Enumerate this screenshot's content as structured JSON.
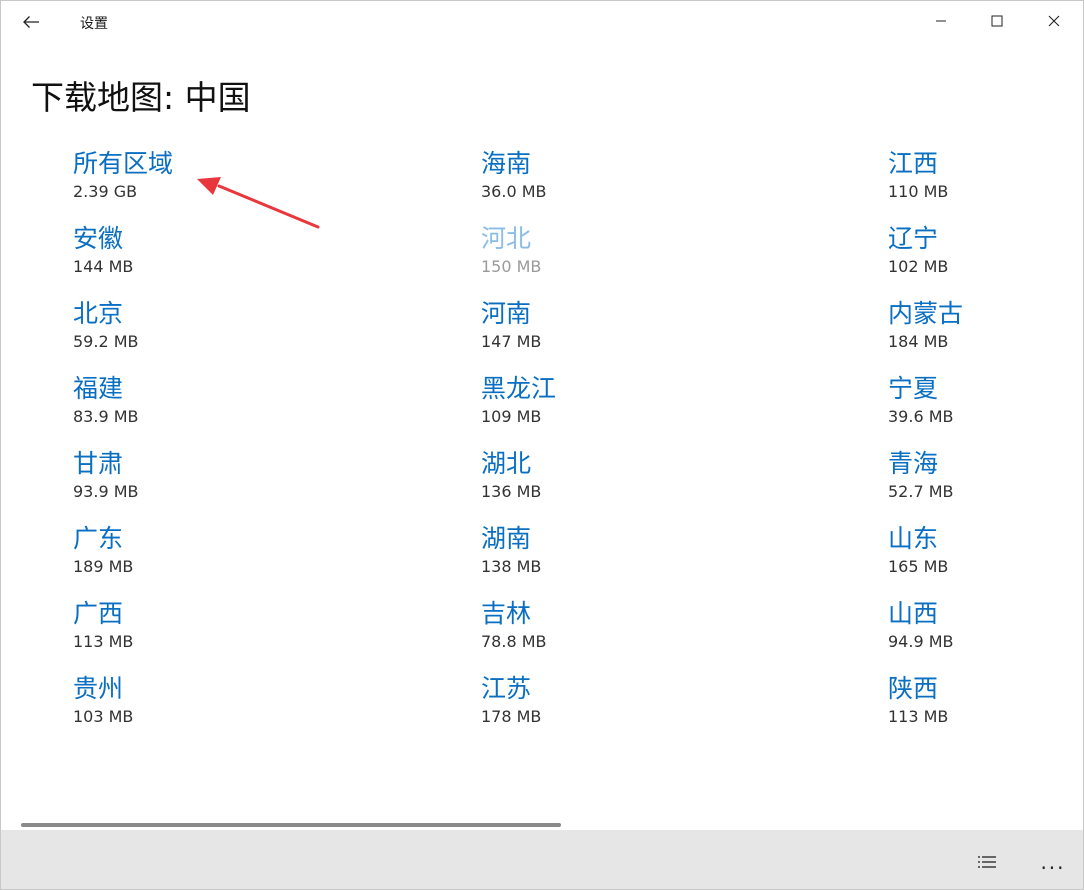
{
  "window": {
    "title": "设置"
  },
  "page": {
    "title": "下载地图: 中国"
  },
  "regions": [
    {
      "name": "所有区域",
      "size": "2.39 GB",
      "disabled": false
    },
    {
      "name": "安徽",
      "size": "144 MB",
      "disabled": false
    },
    {
      "name": "北京",
      "size": "59.2 MB",
      "disabled": false
    },
    {
      "name": "福建",
      "size": "83.9 MB",
      "disabled": false
    },
    {
      "name": "甘肃",
      "size": "93.9 MB",
      "disabled": false
    },
    {
      "name": "广东",
      "size": "189 MB",
      "disabled": false
    },
    {
      "name": "广西",
      "size": "113 MB",
      "disabled": false
    },
    {
      "name": "贵州",
      "size": "103 MB",
      "disabled": false
    },
    {
      "name": "海南",
      "size": "36.0 MB",
      "disabled": false
    },
    {
      "name": "河北",
      "size": "150 MB",
      "disabled": true
    },
    {
      "name": "河南",
      "size": "147 MB",
      "disabled": false
    },
    {
      "name": "黑龙江",
      "size": "109 MB",
      "disabled": false
    },
    {
      "name": "湖北",
      "size": "136 MB",
      "disabled": false
    },
    {
      "name": "湖南",
      "size": "138 MB",
      "disabled": false
    },
    {
      "name": "吉林",
      "size": "78.8 MB",
      "disabled": false
    },
    {
      "name": "江苏",
      "size": "178 MB",
      "disabled": false
    },
    {
      "name": "江西",
      "size": "110 MB",
      "disabled": false
    },
    {
      "name": "辽宁",
      "size": "102 MB",
      "disabled": false
    },
    {
      "name": "内蒙古",
      "size": "184 MB",
      "disabled": false
    },
    {
      "name": "宁夏",
      "size": "39.6 MB",
      "disabled": false
    },
    {
      "name": "青海",
      "size": "52.7 MB",
      "disabled": false
    },
    {
      "name": "山东",
      "size": "165 MB",
      "disabled": false
    },
    {
      "name": "山西",
      "size": "94.9 MB",
      "disabled": false
    },
    {
      "name": "陕西",
      "size": "113 MB",
      "disabled": false
    }
  ],
  "icons": {
    "back": "back-arrow-icon",
    "minimize": "minimize-icon",
    "maximize": "maximize-icon",
    "close": "close-icon",
    "list": "list-icon",
    "more": "more-icon"
  },
  "commandbar": {
    "more_label": "..."
  },
  "colors": {
    "link": "#0a6fc2",
    "link_disabled": "#8cbde6",
    "annotation": "#e8383d",
    "commandbar_bg": "#e6e6e6"
  }
}
